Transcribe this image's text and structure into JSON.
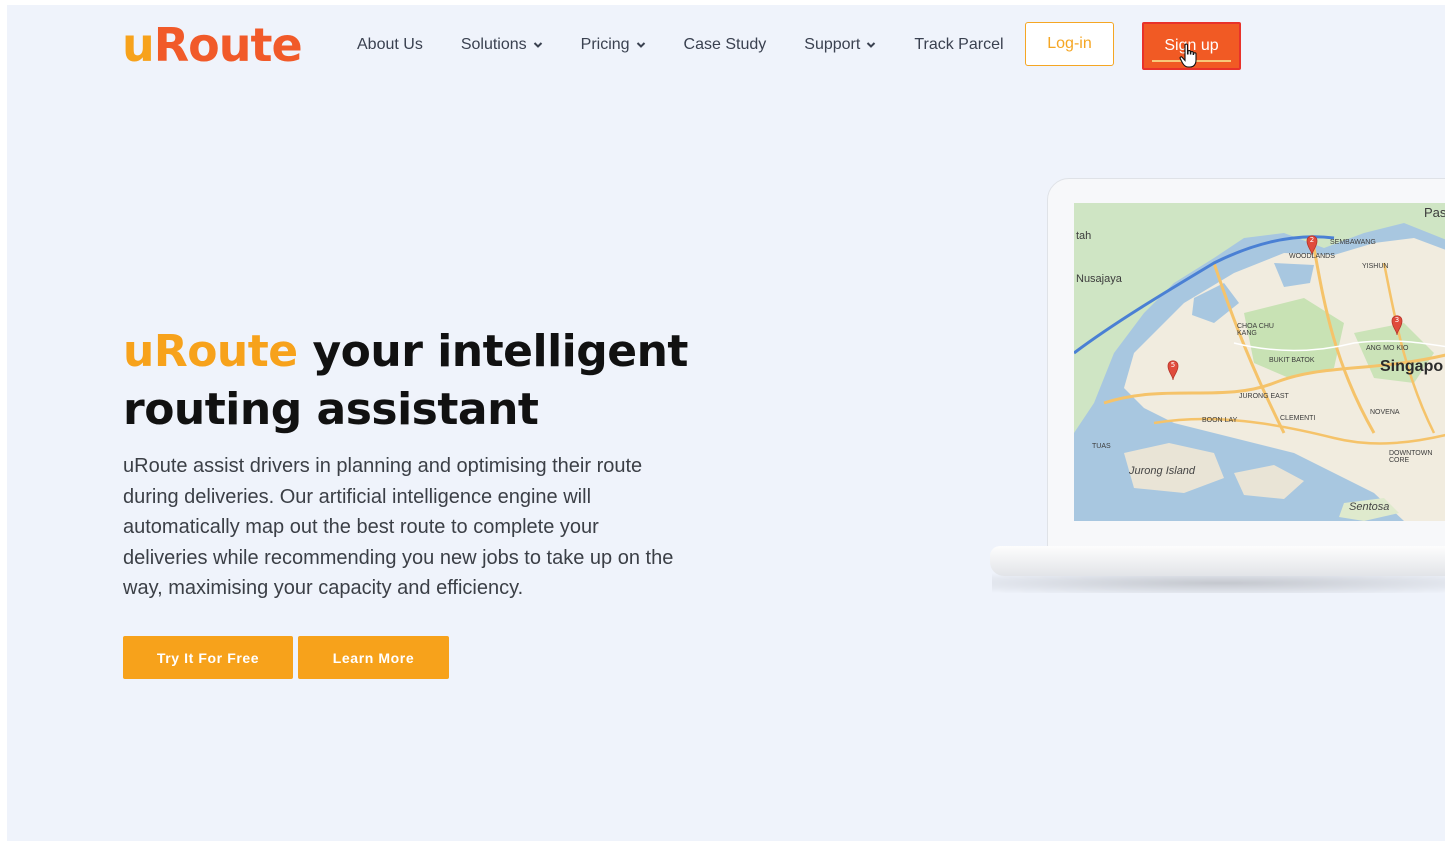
{
  "brand": {
    "logo_u": "u",
    "logo_rest": "Route",
    "colors": {
      "orange": "#f7a21b",
      "red": "#f15a29"
    }
  },
  "nav": {
    "items": [
      {
        "label": "About Us",
        "has_dropdown": false
      },
      {
        "label": "Solutions",
        "has_dropdown": true
      },
      {
        "label": "Pricing",
        "has_dropdown": true
      },
      {
        "label": "Case Study",
        "has_dropdown": false
      },
      {
        "label": "Support",
        "has_dropdown": true
      },
      {
        "label": "Track Parcel",
        "has_dropdown": false
      }
    ],
    "login_label": "Log-in",
    "signup_label": "Sign up"
  },
  "hero": {
    "title_accent": "uRoute",
    "title_rest": "your intelligent routing assistant",
    "description": "uRoute assist drivers in planning and optimising their route during deliveries. Our artificial intelligence engine will automatically map out the best route to complete your deliveries while recommending you new jobs to take up on the way, maximising your capacity and efficiency.",
    "cta_primary": "Try It For Free",
    "cta_secondary": "Learn More"
  },
  "map": {
    "labels": {
      "nusajaya": "Nusajaya",
      "singapore": "Singapo",
      "jurong_island": "Jurong Island",
      "sentosa": "Sentosa",
      "tah": "tah",
      "pas": "Pas",
      "tuas": "TUAS",
      "boon_lay": "BOON LAY",
      "jurong_east": "JURONG EAST",
      "clementi": "CLEMENTI",
      "bukit_batok": "BUKIT BATOK",
      "choa_chu_kang": "CHOA CHU KANG",
      "woodlands": "WOODLANDS",
      "sembawang": "SEMBAWANG",
      "yishun": "YISHUN",
      "ang_mo_kio": "ANG MO KIO",
      "novena": "NOVENA",
      "downtown_core": "DOWNTOWN CORE"
    },
    "pins": [
      "2",
      "3",
      "5"
    ]
  }
}
